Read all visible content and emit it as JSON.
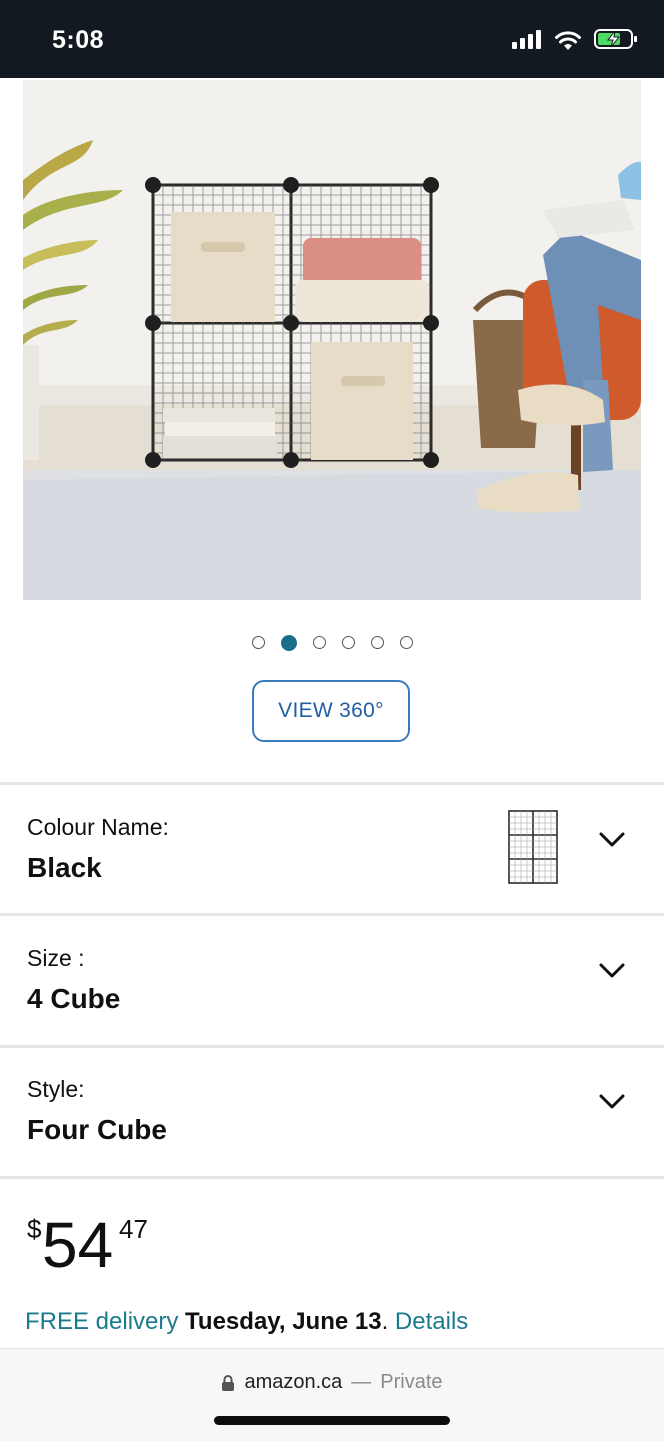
{
  "status_bar": {
    "time": "5:08"
  },
  "gallery": {
    "image_count": 6,
    "active_index": 1,
    "view_360_label": "VIEW 360°"
  },
  "variations": [
    {
      "label": "Colour Name:",
      "value": "Black"
    },
    {
      "label": "Size :",
      "value": "4 Cube"
    },
    {
      "label": "Style:",
      "value": "Four Cube"
    }
  ],
  "price": {
    "currency": "$",
    "whole": "54",
    "fraction": "47"
  },
  "delivery": {
    "free_text": "FREE delivery",
    "date": "Tuesday, June 13",
    "period": ".",
    "details_link": "Details"
  },
  "browser": {
    "domain": "amazon.ca",
    "separator": "—",
    "mode": "Private"
  },
  "colors": {
    "status_bar_bg": "#131921",
    "accent_teal": "#1b7a8c",
    "button_border": "#3a7bbf"
  }
}
